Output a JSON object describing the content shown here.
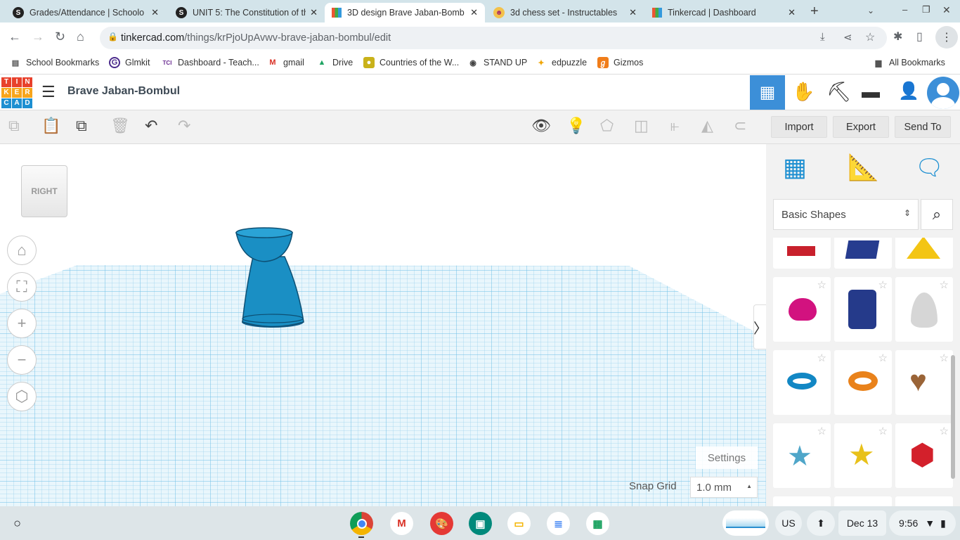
{
  "browser": {
    "tabs": [
      {
        "title": "Grades/Attendance | Schoolo",
        "icon": "schoology-icon",
        "active": false
      },
      {
        "title": "UNIT 5: The Constitution of th",
        "icon": "schoology-icon",
        "active": false
      },
      {
        "title": "3D design Brave Jaban-Bomb",
        "icon": "tinkercad-icon",
        "active": true
      },
      {
        "title": "3d chess set - Instructables",
        "icon": "instructables-icon",
        "active": false
      },
      {
        "title": "Tinkercad | Dashboard",
        "icon": "tinkercad-icon",
        "active": false
      }
    ],
    "url_host": "tinkercad.com",
    "url_path": "/things/krPjoUpAvwv-brave-jaban-bombul/edit",
    "bookmarks": [
      {
        "label": "School Bookmarks",
        "icon": "folder-icon"
      },
      {
        "label": "Glmkit",
        "icon": "gimkit-icon"
      },
      {
        "label": "Dashboard - Teach...",
        "icon": "tci-icon"
      },
      {
        "label": "gmail",
        "icon": "gmail-icon"
      },
      {
        "label": "Drive",
        "icon": "drive-icon"
      },
      {
        "label": "Countries of the W...",
        "icon": "countries-icon"
      },
      {
        "label": "STAND UP",
        "icon": "globe-icon"
      },
      {
        "label": "edpuzzle",
        "icon": "edpuzzle-icon"
      },
      {
        "label": "Gizmos",
        "icon": "gizmos-icon"
      }
    ],
    "all_bookmarks": "All Bookmarks"
  },
  "tinkercad": {
    "logo_letters": [
      "T",
      "I",
      "N",
      "K",
      "E",
      "R",
      "C",
      "A",
      "D"
    ],
    "design_title": "Brave Jaban-Bombul",
    "import": "Import",
    "export": "Export",
    "send_to": "Send To",
    "viewcube_face": "RIGHT",
    "shape_library": "Basic Shapes",
    "settings": "Settings",
    "snap_grid_label": "Snap Grid",
    "snap_grid_value": "1.0 mm",
    "accent": "#3c8fd8",
    "shape_color": "#1a8fc4"
  },
  "shelf": {
    "ime": "US",
    "date": "Dec 13",
    "time": "9:56"
  }
}
